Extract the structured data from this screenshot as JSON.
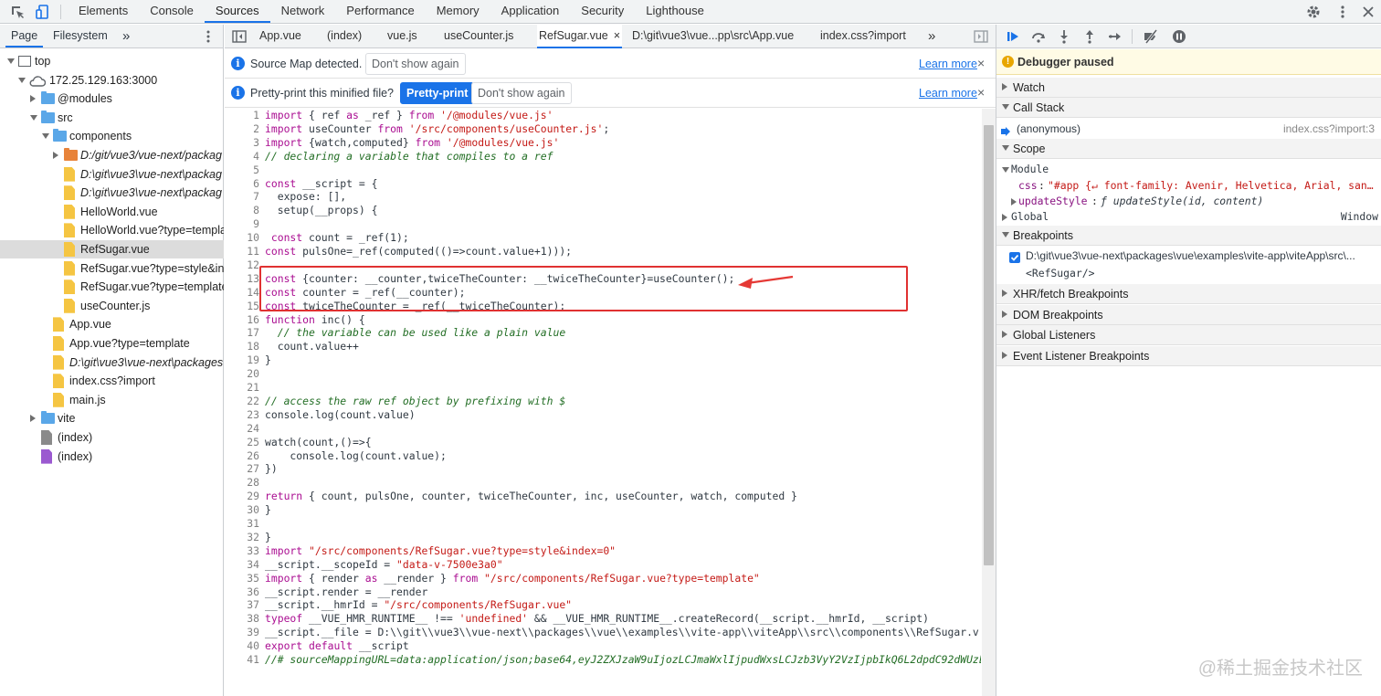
{
  "devtools_tabs": [
    "Elements",
    "Console",
    "Sources",
    "Network",
    "Performance",
    "Memory",
    "Application",
    "Security",
    "Lighthouse"
  ],
  "active_devtools_tab": "Sources",
  "navigator": {
    "tabs": [
      "Page",
      "Filesystem"
    ],
    "more": "»",
    "tree": [
      {
        "label": "top",
        "type": "frame",
        "depth": 0,
        "expanded": true
      },
      {
        "label": "172.25.129.163:3000",
        "type": "cloud",
        "depth": 1,
        "expanded": true
      },
      {
        "label": "@modules",
        "type": "folder",
        "depth": 2,
        "expanded": false
      },
      {
        "label": "src",
        "type": "folder",
        "depth": 2,
        "expanded": true
      },
      {
        "label": "components",
        "type": "folder",
        "depth": 3,
        "expanded": true
      },
      {
        "label": "D:/git/vue3/vue-next/packag",
        "type": "folder-orange",
        "depth": 4,
        "expanded": false,
        "italic": true
      },
      {
        "label": "D:\\git\\vue3\\vue-next\\packag",
        "type": "file-yellow",
        "depth": 4,
        "italic": true
      },
      {
        "label": "D:\\git\\vue3\\vue-next\\packag",
        "type": "file-yellow",
        "depth": 4,
        "italic": true
      },
      {
        "label": "HelloWorld.vue",
        "type": "file-yellow",
        "depth": 4
      },
      {
        "label": "HelloWorld.vue?type=templa",
        "type": "file-yellow",
        "depth": 4
      },
      {
        "label": "RefSugar.vue",
        "type": "file-yellow",
        "depth": 4,
        "selected": true
      },
      {
        "label": "RefSugar.vue?type=style&in",
        "type": "file-yellow",
        "depth": 4
      },
      {
        "label": "RefSugar.vue?type=template",
        "type": "file-yellow",
        "depth": 4
      },
      {
        "label": "useCounter.js",
        "type": "file-yellow",
        "depth": 4
      },
      {
        "label": "App.vue",
        "type": "file-yellow",
        "depth": 3
      },
      {
        "label": "App.vue?type=template",
        "type": "file-yellow",
        "depth": 3
      },
      {
        "label": "D:\\git\\vue3\\vue-next\\packages",
        "type": "file-yellow",
        "depth": 3,
        "italic": true
      },
      {
        "label": "index.css?import",
        "type": "file-yellow",
        "depth": 3
      },
      {
        "label": "main.js",
        "type": "file-yellow",
        "depth": 3
      },
      {
        "label": "vite",
        "type": "folder",
        "depth": 2,
        "expanded": false
      },
      {
        "label": "(index)",
        "type": "file-gray",
        "depth": 2
      },
      {
        "label": "(index)",
        "type": "file-purple",
        "depth": 2
      }
    ]
  },
  "editor": {
    "tabs": [
      "App.vue",
      "(index)",
      "vue.js",
      "useCounter.js",
      "RefSugar.vue",
      "D:\\git\\vue3\\vue...pp\\src\\App.vue",
      "index.css?import"
    ],
    "active_tab": "RefSugar.vue",
    "tab_close": "×",
    "more": "»",
    "sourcemap_bar": {
      "text": "Source Map detected.",
      "dont_show": "Don't show again",
      "learn_more": "Learn more",
      "close": "×"
    },
    "prettyprint_bar": {
      "text": "Pretty-print this minified file?",
      "pretty_print": "Pretty-print",
      "dont_show": "Don't show again",
      "learn_more": "Learn more",
      "close": "×"
    },
    "lines": [
      "import { ref as _ref } from '/@modules/vue.js'",
      "import useCounter from '/src/components/useCounter.js';",
      "import {watch,computed} from '/@modules/vue.js'",
      "// declaring a variable that compiles to a ref",
      "",
      "const __script = {",
      "  expose: [],",
      "  setup(__props) {",
      "",
      " const count = _ref(1);",
      "const pulsOne=_ref(computed(()=>count.value+1)));",
      "",
      "const {counter: __counter,twiceTheCounter: __twiceTheCounter}=useCounter();",
      "const counter = _ref(__counter);",
      "const twiceTheCounter = _ref(__twiceTheCounter);",
      "function inc() {",
      "  // the variable can be used like a plain value",
      "  count.value++",
      "}",
      "",
      "",
      "// access the raw ref object by prefixing with $",
      "console.log(count.value)",
      "",
      "watch(count,()=>{",
      "    console.log(count.value);",
      "})",
      "",
      "return { count, pulsOne, counter, twiceTheCounter, inc, useCounter, watch, computed }",
      "}",
      "",
      "}",
      "import \"/src/components/RefSugar.vue?type=style&index=0\"",
      "__script.__scopeId = \"data-v-7500e3a0\"",
      "import { render as __render } from \"/src/components/RefSugar.vue?type=template\"",
      "__script.render = __render",
      "__script.__hmrId = \"/src/components/RefSugar.vue\"",
      "typeof __VUE_HMR_RUNTIME__ !== 'undefined' && __VUE_HMR_RUNTIME__.createRecord(__script.__hmrId, __script)",
      "__script.__file = \"D:\\\\git\\\\vue3\\\\vue-next\\\\packages\\\\vue\\\\examples\\\\vite-app\\\\viteApp\\\\src\\\\components\\\\RefSugar.v",
      "export default __script",
      "//# sourceMappingURL=data:application/json;base64,eyJ2ZXJzaW9uIjozLCJmaWxlIjpudWxsLCJzb3VyY2VzIjpbIkQ6L2dpdC92dWUzL"
    ]
  },
  "debugger": {
    "paused_label": "Debugger paused",
    "sections": {
      "watch": "Watch",
      "call_stack": "Call Stack",
      "scope": "Scope",
      "breakpoints": "Breakpoints",
      "xhr": "XHR/fetch Breakpoints",
      "dom": "DOM Breakpoints",
      "global_listeners": "Global Listeners",
      "event_listeners": "Event Listener Breakpoints"
    },
    "call_stack": [
      {
        "name": "(anonymous)",
        "location": "index.css?import:3"
      }
    ],
    "scope": {
      "module_label": "Module",
      "css_key": "css",
      "css_value": "\"#app {↵  font-family: Avenir, Helvetica, Arial, san…",
      "update_key": "updateStyle",
      "update_value": "ƒ updateStyle(id, content)",
      "global_label": "Global",
      "global_value": "Window"
    },
    "breakpoint": {
      "path": "D:\\git\\vue3\\vue-next\\packages\\vue\\examples\\vite-app\\viteApp\\src\\...",
      "code": "<RefSugar/>",
      "checked": true
    }
  },
  "watermark": "@稀土掘金技术社区",
  "colors": {
    "accent": "#1a73e8",
    "highlight_box": "#e03131",
    "arrow": "#e53935",
    "paused_bg": "#fffbe5"
  }
}
